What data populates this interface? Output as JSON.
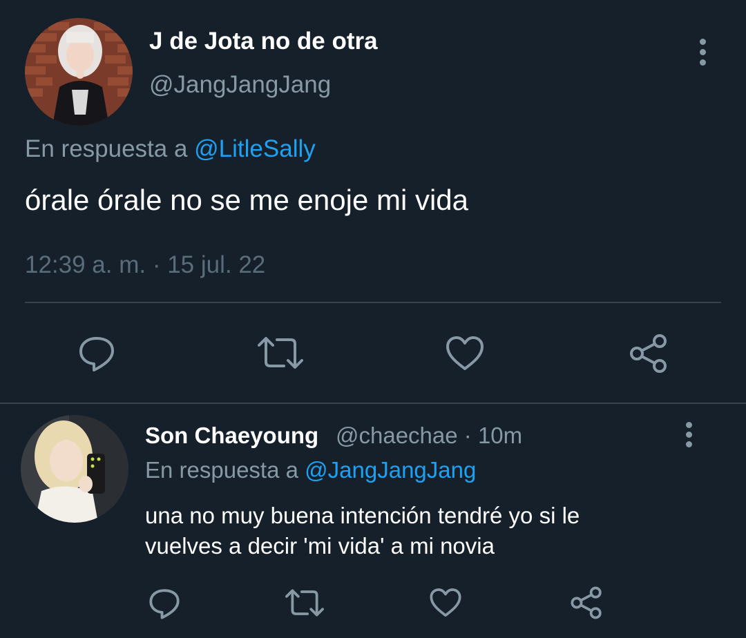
{
  "main_tweet": {
    "display_name": "J de Jota no de otra",
    "handle": "@JangJangJang",
    "reply_prefix": "En respuesta a ",
    "reply_to": "@LitleSally",
    "text": "órale órale no se me enoje mi vida",
    "timestamp": "12:39 a. m. · 15 jul. 22",
    "actions": [
      "reply-icon",
      "retweet-icon",
      "like-icon",
      "share-icon"
    ]
  },
  "reply_tweet": {
    "display_name": "Son Chaeyoung",
    "handle_meta": "@chaechae · 10m",
    "reply_prefix": "En respuesta a ",
    "reply_to": "@JangJangJang",
    "text_lines": [
      "una no muy buena intención tendré yo si le",
      "vuelves a decir 'mi vida' a mi novia"
    ],
    "actions": [
      "reply-icon",
      "retweet-icon",
      "like-icon",
      "share-icon"
    ]
  },
  "colors": {
    "background": "#15202b",
    "primary_text": "#ffffff",
    "secondary_text": "#8899a6",
    "timestamp_text": "#5b6c7a",
    "mention": "#1da1f2",
    "divider": "#38444d"
  }
}
